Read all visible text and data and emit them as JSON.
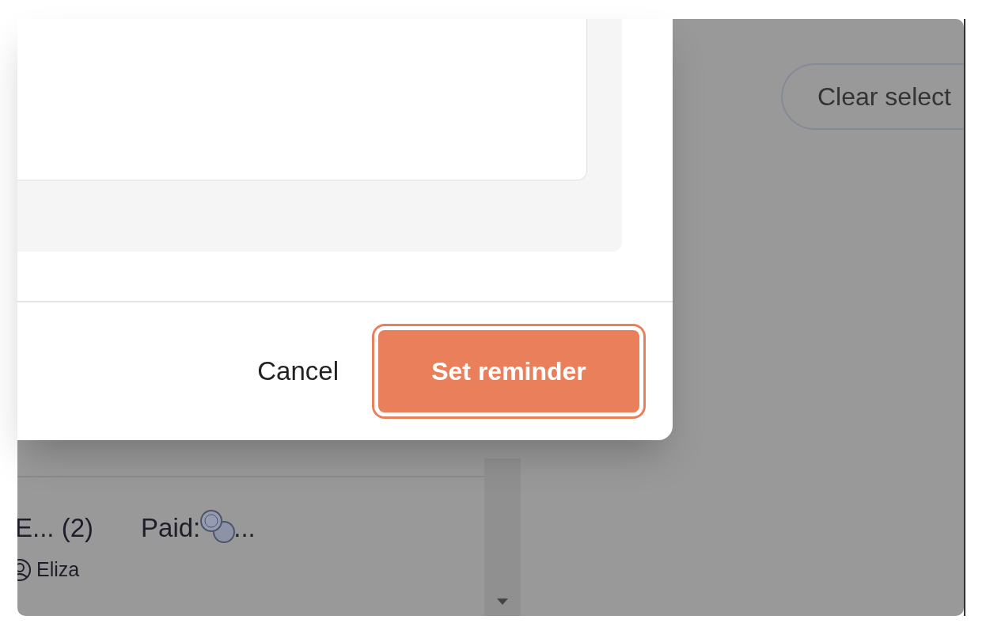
{
  "modal": {
    "buttons": [
      {
        "label": "Cancel",
        "kind": "text"
      },
      {
        "label": "Set reminder",
        "kind": "primary",
        "focused": true
      }
    ]
  },
  "background": {
    "clear_button": "Clear select",
    "card": {
      "title": "E... (2)",
      "paid_label": "Paid:",
      "paid_tail": "...",
      "assignee": "Eliza"
    }
  }
}
